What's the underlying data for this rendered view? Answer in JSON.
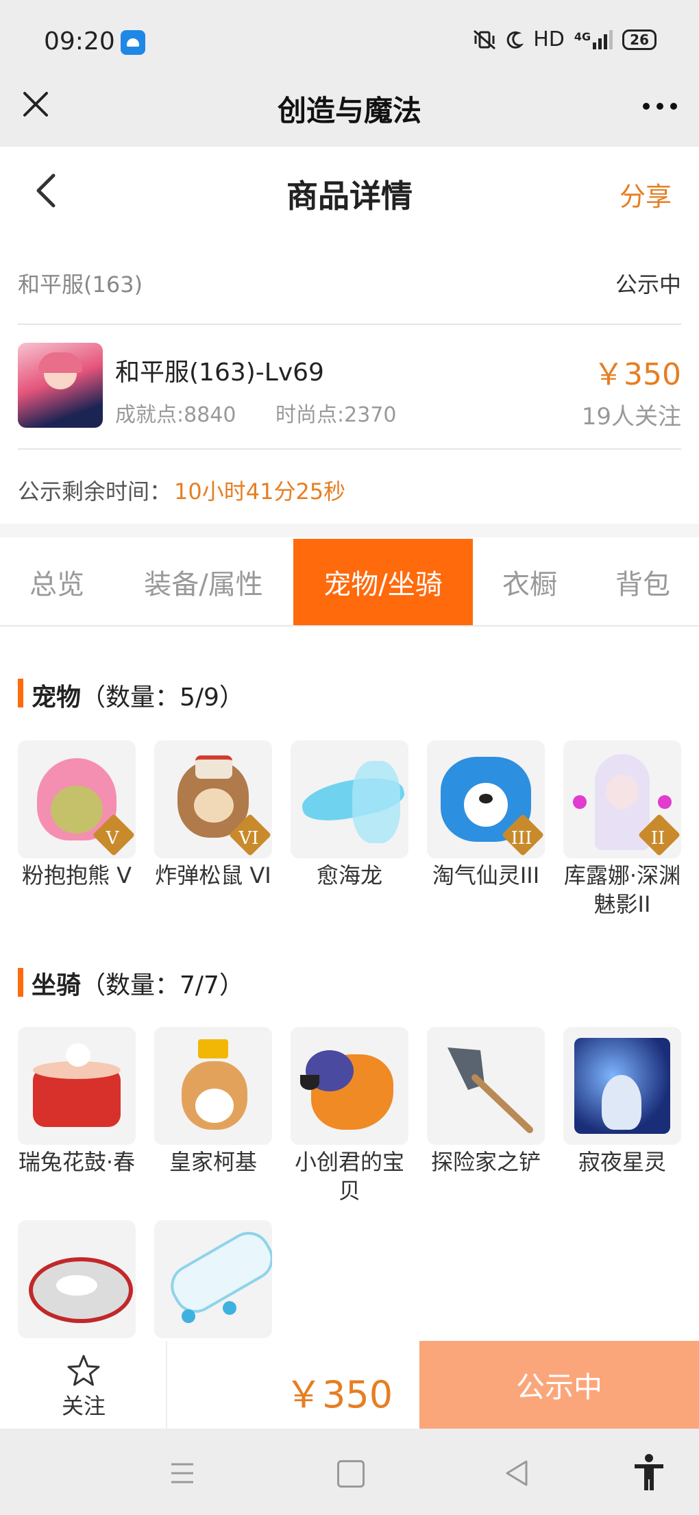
{
  "status_bar": {
    "time": "09:20",
    "network": "HD",
    "signal": "4G",
    "battery": "26"
  },
  "app_nav": {
    "title": "创造与魔法"
  },
  "page": {
    "title": "商品详情",
    "share_label": "分享"
  },
  "listing": {
    "server": "和平服(163)",
    "status": "公示中",
    "product_name": "和平服(163)-Lv69",
    "achievement": "成就点:8840",
    "fashion": "时尚点:2370",
    "price": "￥350",
    "followers": "19人关注",
    "remaining_label": "公示剩余时间：",
    "remaining_value": "10小时41分25秒"
  },
  "tabs": [
    {
      "label": "总览"
    },
    {
      "label": "装备/属性"
    },
    {
      "label": "宠物/坐骑",
      "active": true
    },
    {
      "label": "衣橱"
    },
    {
      "label": "背包"
    }
  ],
  "pets": {
    "title": "宠物",
    "count": "（数量：5/9）",
    "items": [
      {
        "name": "粉抱抱熊 V",
        "badge": "V",
        "icon": "pink-bear-icon"
      },
      {
        "name": "炸弹松鼠 VI",
        "badge": "VI",
        "icon": "bomb-squirrel-icon"
      },
      {
        "name": "愈海龙",
        "badge": "",
        "icon": "sea-dragon-icon"
      },
      {
        "name": "淘气仙灵III",
        "badge": "III",
        "icon": "blue-puppy-icon"
      },
      {
        "name": "库露娜·深渊魅影II",
        "badge": "II",
        "icon": "abyss-phantom-icon"
      }
    ]
  },
  "mounts": {
    "title": "坐骑",
    "count": "（数量：7/7）",
    "items": [
      {
        "name": "瑞兔花鼓·春",
        "icon": "rabbit-drum-icon"
      },
      {
        "name": "皇家柯基",
        "icon": "royal-corgi-icon"
      },
      {
        "name": "小创君的宝贝",
        "icon": "phoenix-bird-icon"
      },
      {
        "name": "探险家之铲",
        "icon": "shovel-icon"
      },
      {
        "name": "寂夜星灵",
        "icon": "night-spirit-icon"
      },
      {
        "name": "",
        "icon": "silver-mask-icon"
      },
      {
        "name": "",
        "icon": "skateboard-icon"
      }
    ]
  },
  "bottom_bar": {
    "follow_label": "关注",
    "price": "￥350",
    "buy_label": "公示中"
  },
  "colors": {
    "accent": "#ff6a0d",
    "price": "#e67e22",
    "buy_button": "#fba67a"
  }
}
